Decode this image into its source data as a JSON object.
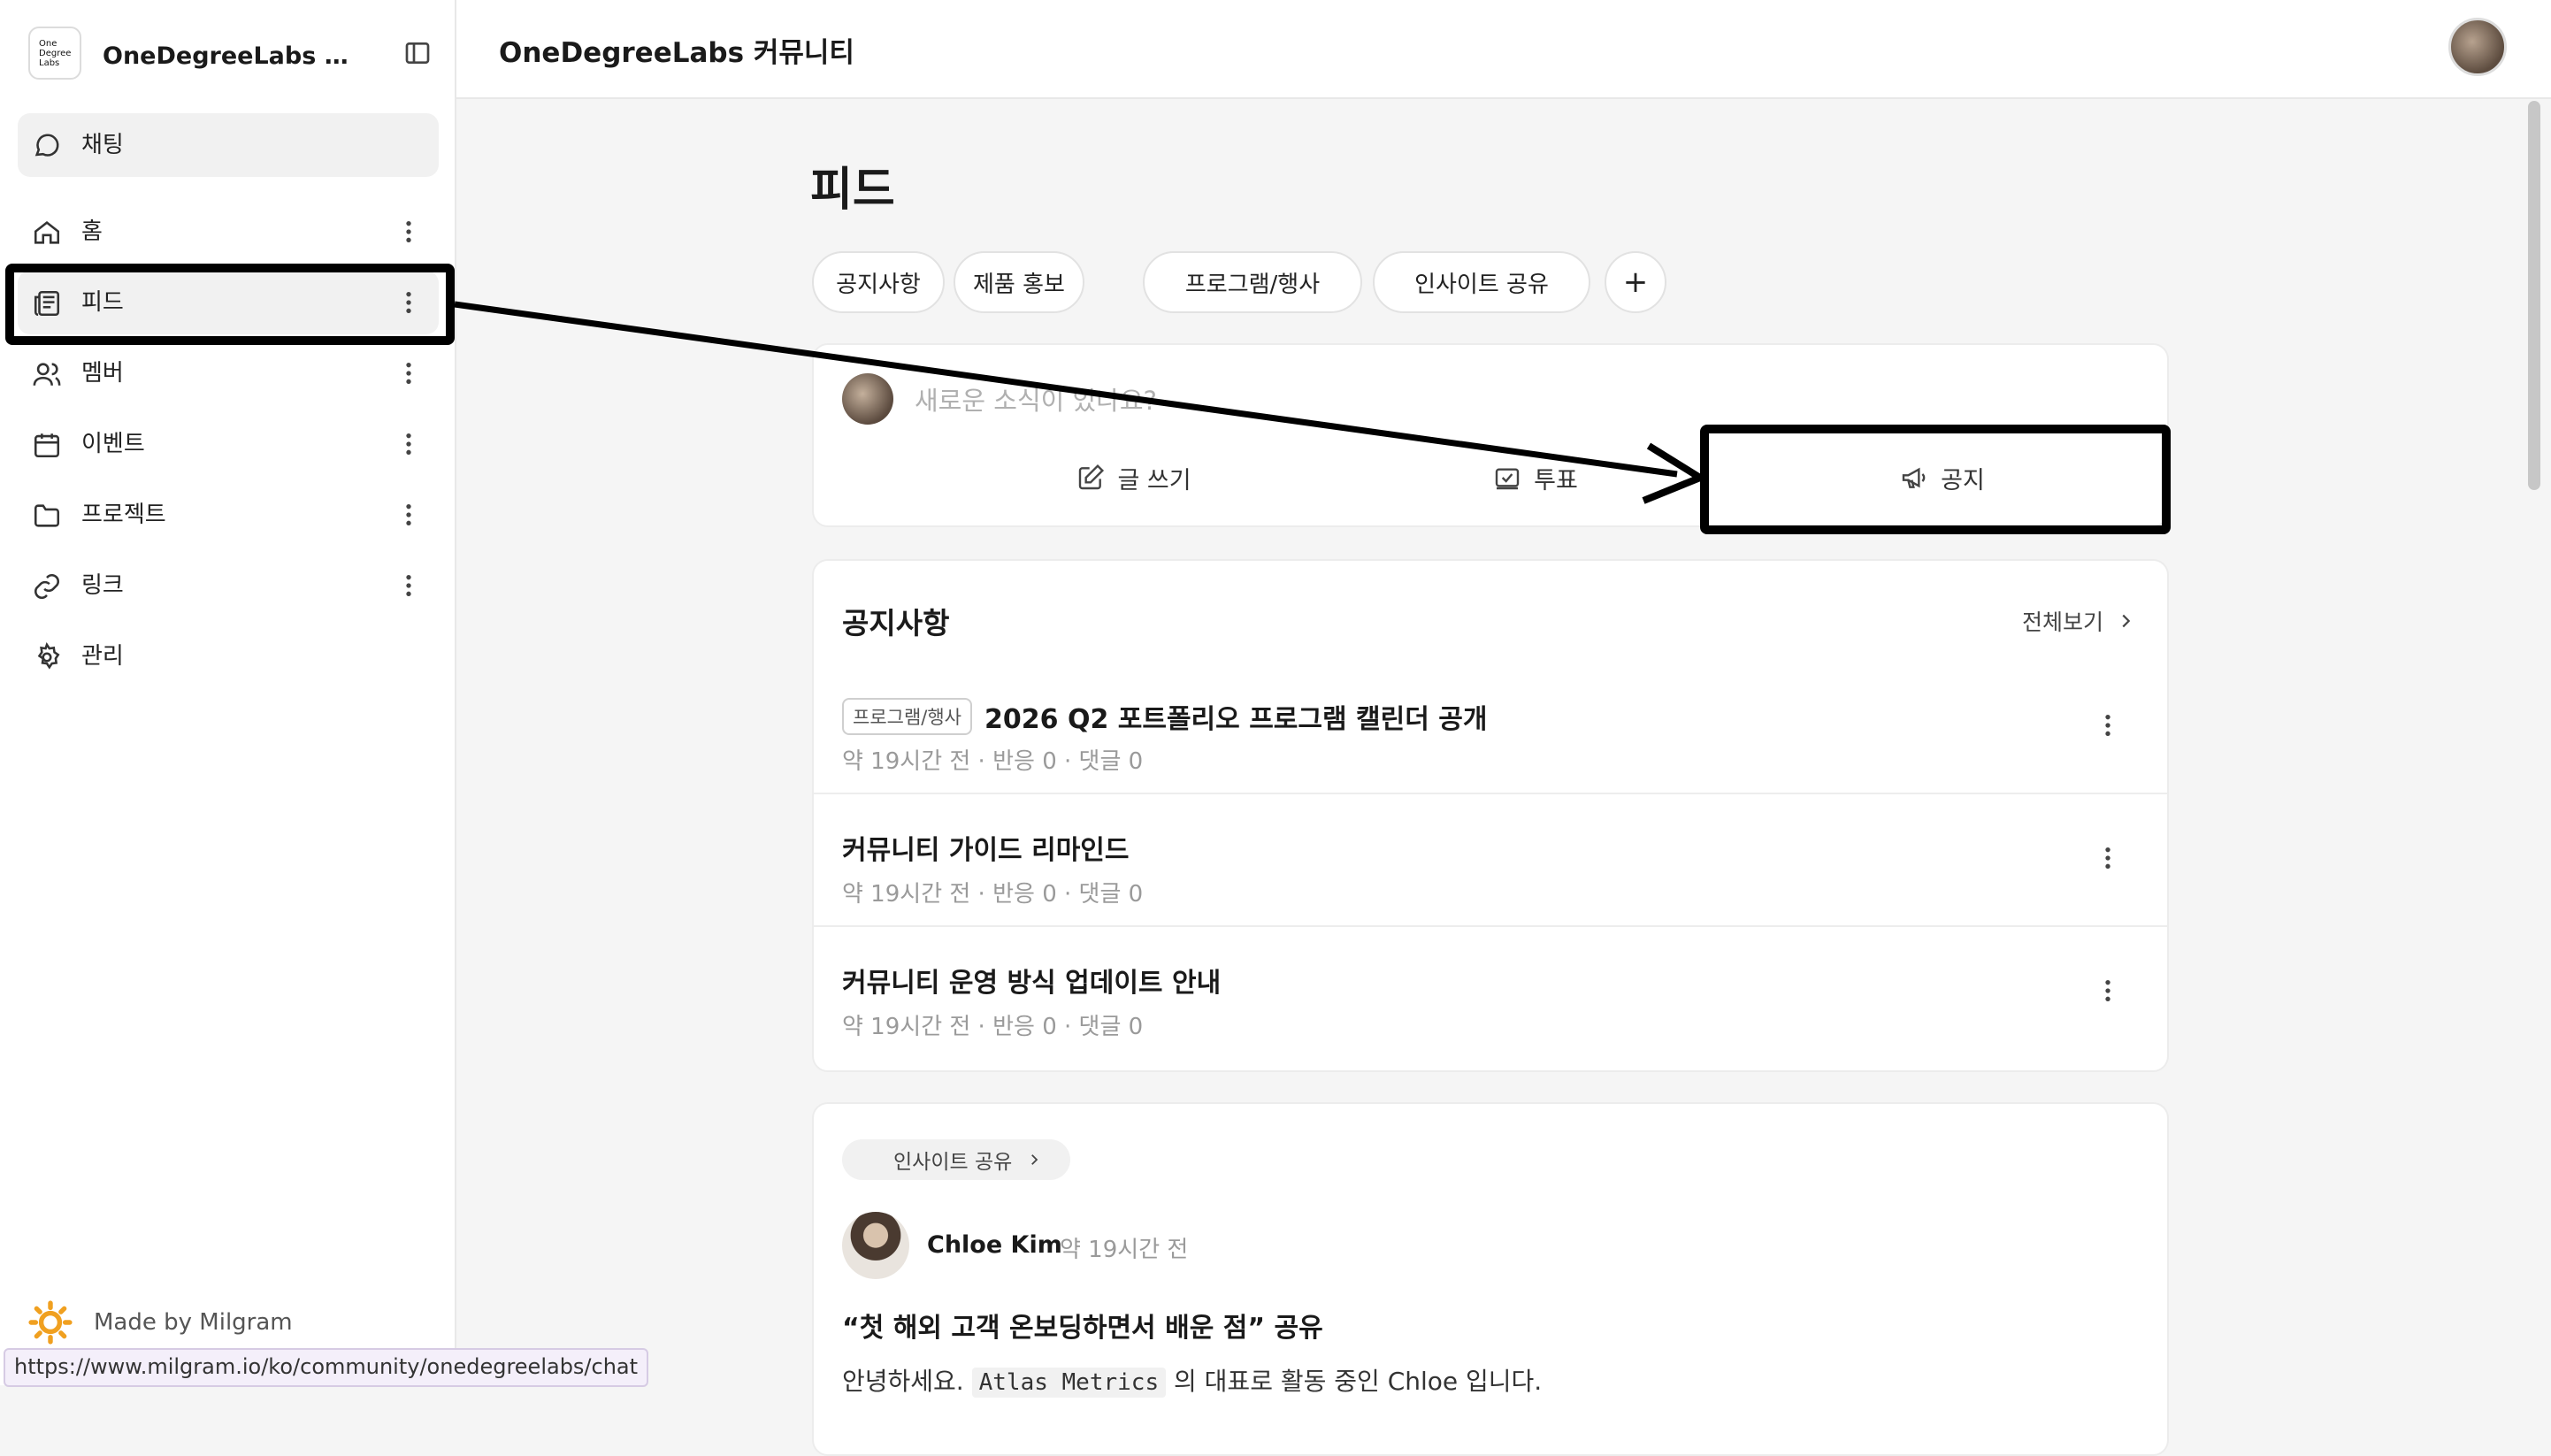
{
  "brand": {
    "logo_text": [
      "One",
      "Degree",
      "Labs"
    ],
    "name": "OneDegreeLabs 커뮤..."
  },
  "sidebar": {
    "chat_label": "채팅",
    "items": [
      {
        "label": "홈",
        "icon": "home-icon"
      },
      {
        "label": "피드",
        "icon": "newspaper-icon",
        "active": true
      },
      {
        "label": "멤버",
        "icon": "users-icon"
      },
      {
        "label": "이벤트",
        "icon": "calendar-icon"
      },
      {
        "label": "프로젝트",
        "icon": "folder-icon"
      },
      {
        "label": "링크",
        "icon": "link-icon"
      },
      {
        "label": "관리",
        "icon": "gear-icon"
      }
    ],
    "footer": "Made by Milgram"
  },
  "status_url": "https://www.milgram.io/ko/community/onedegreelabs/chat",
  "header": {
    "title": "OneDegreeLabs 커뮤니티"
  },
  "page": {
    "title": "피드"
  },
  "filters": [
    "공지사항",
    "제품 홍보",
    "프로그램/행사",
    "인사이트 공유"
  ],
  "composer": {
    "placeholder": "새로운 소식이 있나요?",
    "actions": {
      "write": "글 쓰기",
      "poll": "투표",
      "notice": "공지"
    }
  },
  "notices": {
    "title": "공지사항",
    "see_all": "전체보기",
    "items": [
      {
        "tag": "프로그램/행사",
        "title": "2026 Q2 포트폴리오 프로그램 캘린더 공개",
        "time": "약 19시간 전",
        "reactions": "반응 0",
        "comments": "댓글 0"
      },
      {
        "tag": "",
        "title": "커뮤니티 가이드 리마인드",
        "time": "약 19시간 전",
        "reactions": "반응 0",
        "comments": "댓글 0"
      },
      {
        "tag": "",
        "title": "커뮤니티 운영 방식 업데이트 안내",
        "time": "약 19시간 전",
        "reactions": "반응 0",
        "comments": "댓글 0"
      }
    ]
  },
  "post": {
    "category": "인사이트 공유",
    "author": "Chloe Kim",
    "time": "약 19시간 전",
    "title": "“첫 해외 고객 온보딩하면서 배운 점” 공유",
    "body_prefix": "안녕하세요.",
    "body_code": "Atlas Metrics",
    "body_suffix": "의 대표로 활동 중인 Chloe 입니다."
  },
  "colors": {
    "highlight": "#000000",
    "sidebar_active": "#f1f1f1",
    "footer_logo": "#f0a020"
  }
}
